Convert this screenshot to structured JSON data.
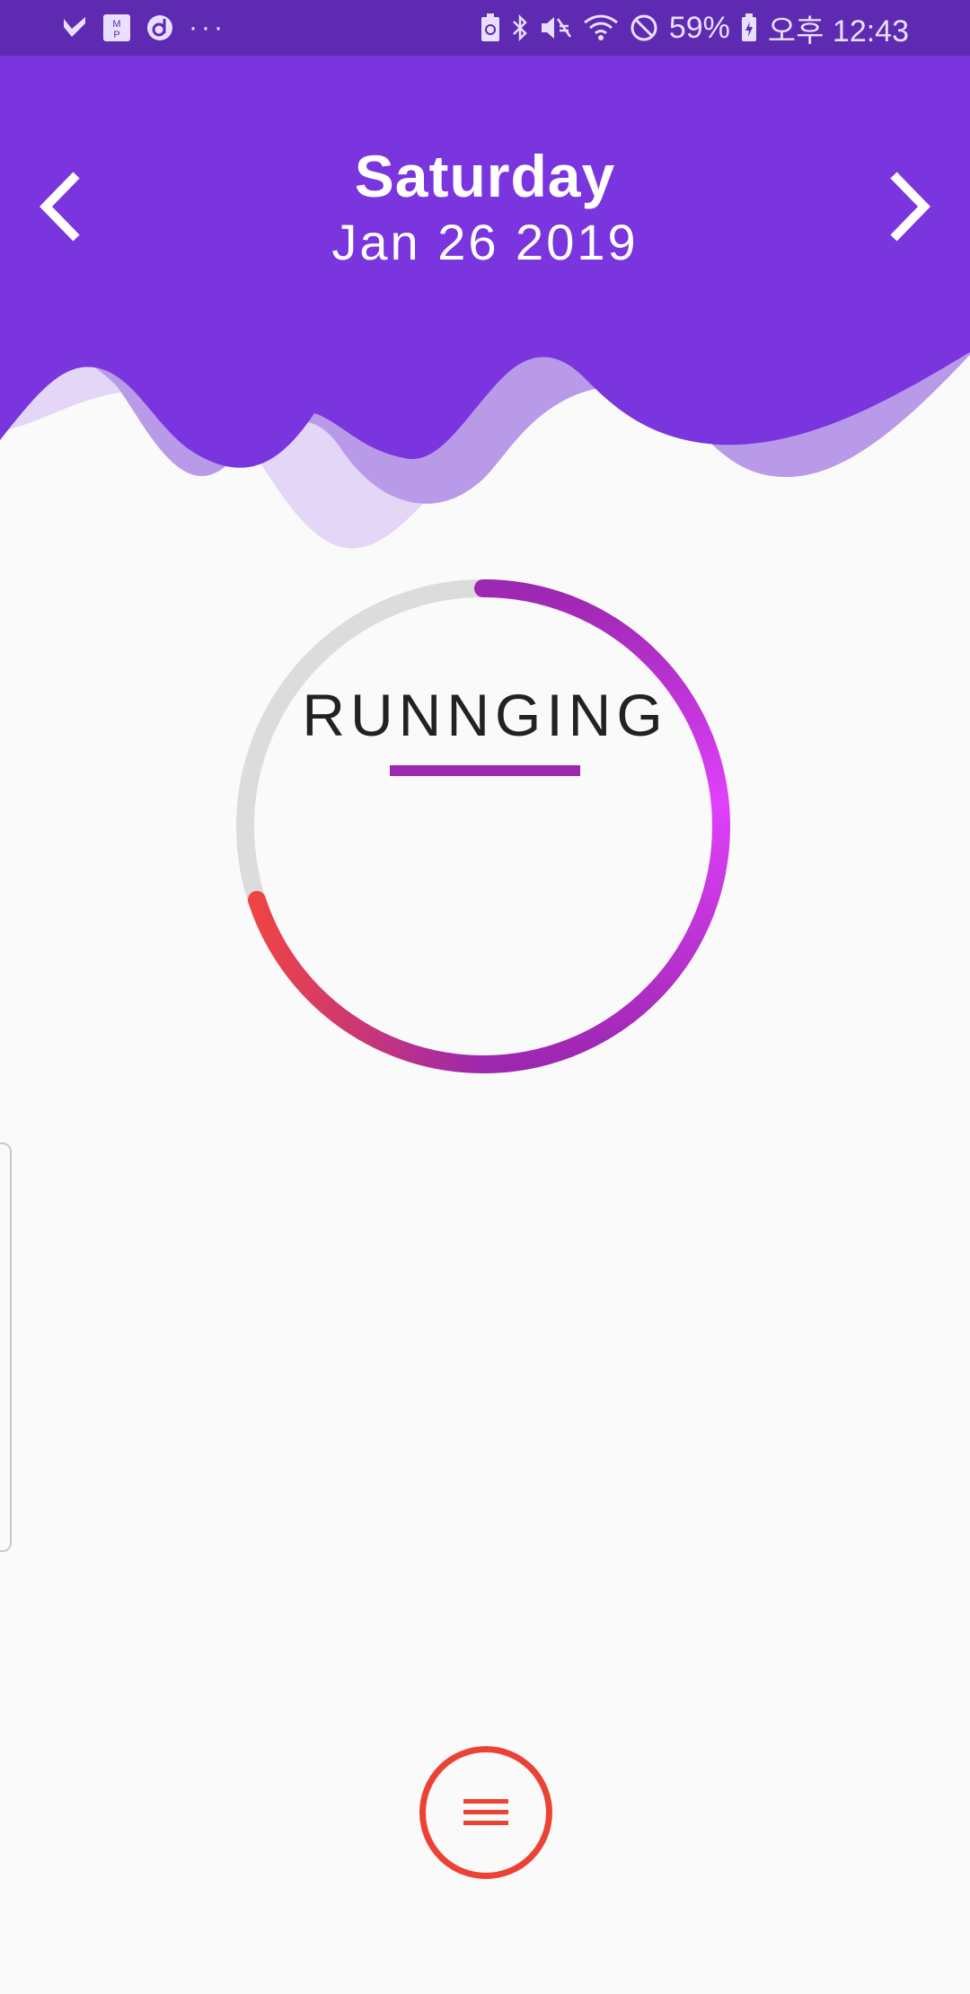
{
  "status_bar": {
    "battery_percent": "59%",
    "time": "오후 12:43",
    "left_icons": [
      "check-app-icon",
      "mp-app-icon",
      "d-app-icon",
      "more-dots-icon"
    ],
    "right_icons": [
      "battery-saver-icon",
      "bluetooth-icon",
      "mute-icon",
      "wifi-icon",
      "dnd-icon",
      "battery-icon"
    ]
  },
  "header": {
    "day": "Saturday",
    "date": "Jan 26 2019",
    "prev_icon": "chevron-left-icon",
    "next_icon": "chevron-right-icon"
  },
  "activity": {
    "label": "RUNNGING",
    "progress_fraction": 0.7
  },
  "fab": {
    "icon": "menu-icon"
  },
  "colors": {
    "header_purple": "#7a35de",
    "status_purple": "#5e2ab2",
    "wave_light": "#e3d6f6",
    "wave_mid": "#b89ae9",
    "ring_track": "#dcdcdc",
    "ring_start": "#9c27b0",
    "ring_mid": "#e040fb",
    "ring_end": "#ef4444",
    "fab_red": "#ea4335"
  }
}
